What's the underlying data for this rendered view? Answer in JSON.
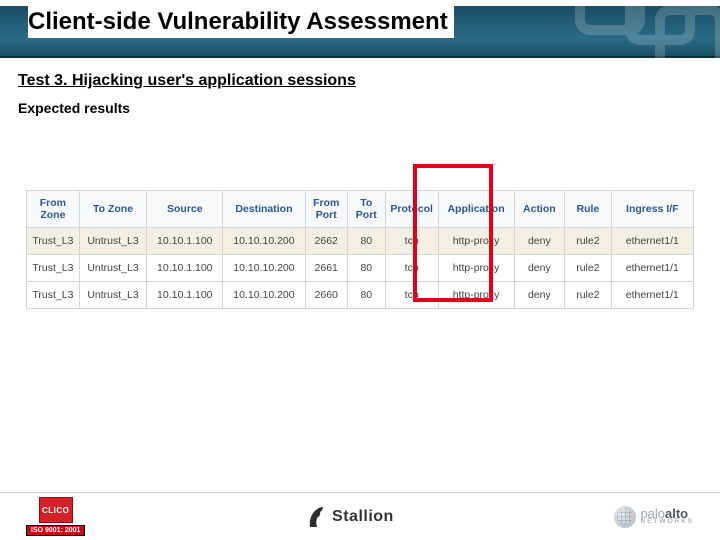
{
  "header": {
    "title": "Client-side Vulnerability Assessment"
  },
  "subheader": {
    "test_title": "Test 3. Hijacking user's application sessions",
    "expected_label": "Expected results"
  },
  "table": {
    "headers": {
      "from_zone": "From Zone",
      "to_zone": "To Zone",
      "source": "Source",
      "destination": "Destination",
      "from_port": "From Port",
      "to_port": "To Port",
      "protocol": "Protocol",
      "application": "Application",
      "action": "Action",
      "rule": "Rule",
      "ingress_if": "Ingress I/F"
    },
    "rows": [
      {
        "from_zone": "Trust_L3",
        "to_zone": "Untrust_L3",
        "source": "10.10.1.100",
        "destination": "10.10.10.200",
        "from_port": "2662",
        "to_port": "80",
        "protocol": "tcp",
        "application": "http-proxy",
        "action": "deny",
        "rule": "rule2",
        "ingress_if": "ethernet1/1"
      },
      {
        "from_zone": "Trust_L3",
        "to_zone": "Untrust_L3",
        "source": "10.10.1.100",
        "destination": "10.10.10.200",
        "from_port": "2661",
        "to_port": "80",
        "protocol": "tcp",
        "application": "http-proxy",
        "action": "deny",
        "rule": "rule2",
        "ingress_if": "ethernet1/1"
      },
      {
        "from_zone": "Trust_L3",
        "to_zone": "Untrust_L3",
        "source": "10.10.1.100",
        "destination": "10.10.10.200",
        "from_port": "2660",
        "to_port": "80",
        "protocol": "tcp",
        "application": "http-proxy",
        "action": "deny",
        "rule": "rule2",
        "ingress_if": "ethernet1/1"
      }
    ]
  },
  "footer": {
    "clico_label": "CLICO",
    "iso_label": "ISO 9001: 2001",
    "stallion_label": "Stallion",
    "paloalto_light": "palo",
    "paloalto_dark": "alto",
    "paloalto_sub": "NETWORKS"
  }
}
